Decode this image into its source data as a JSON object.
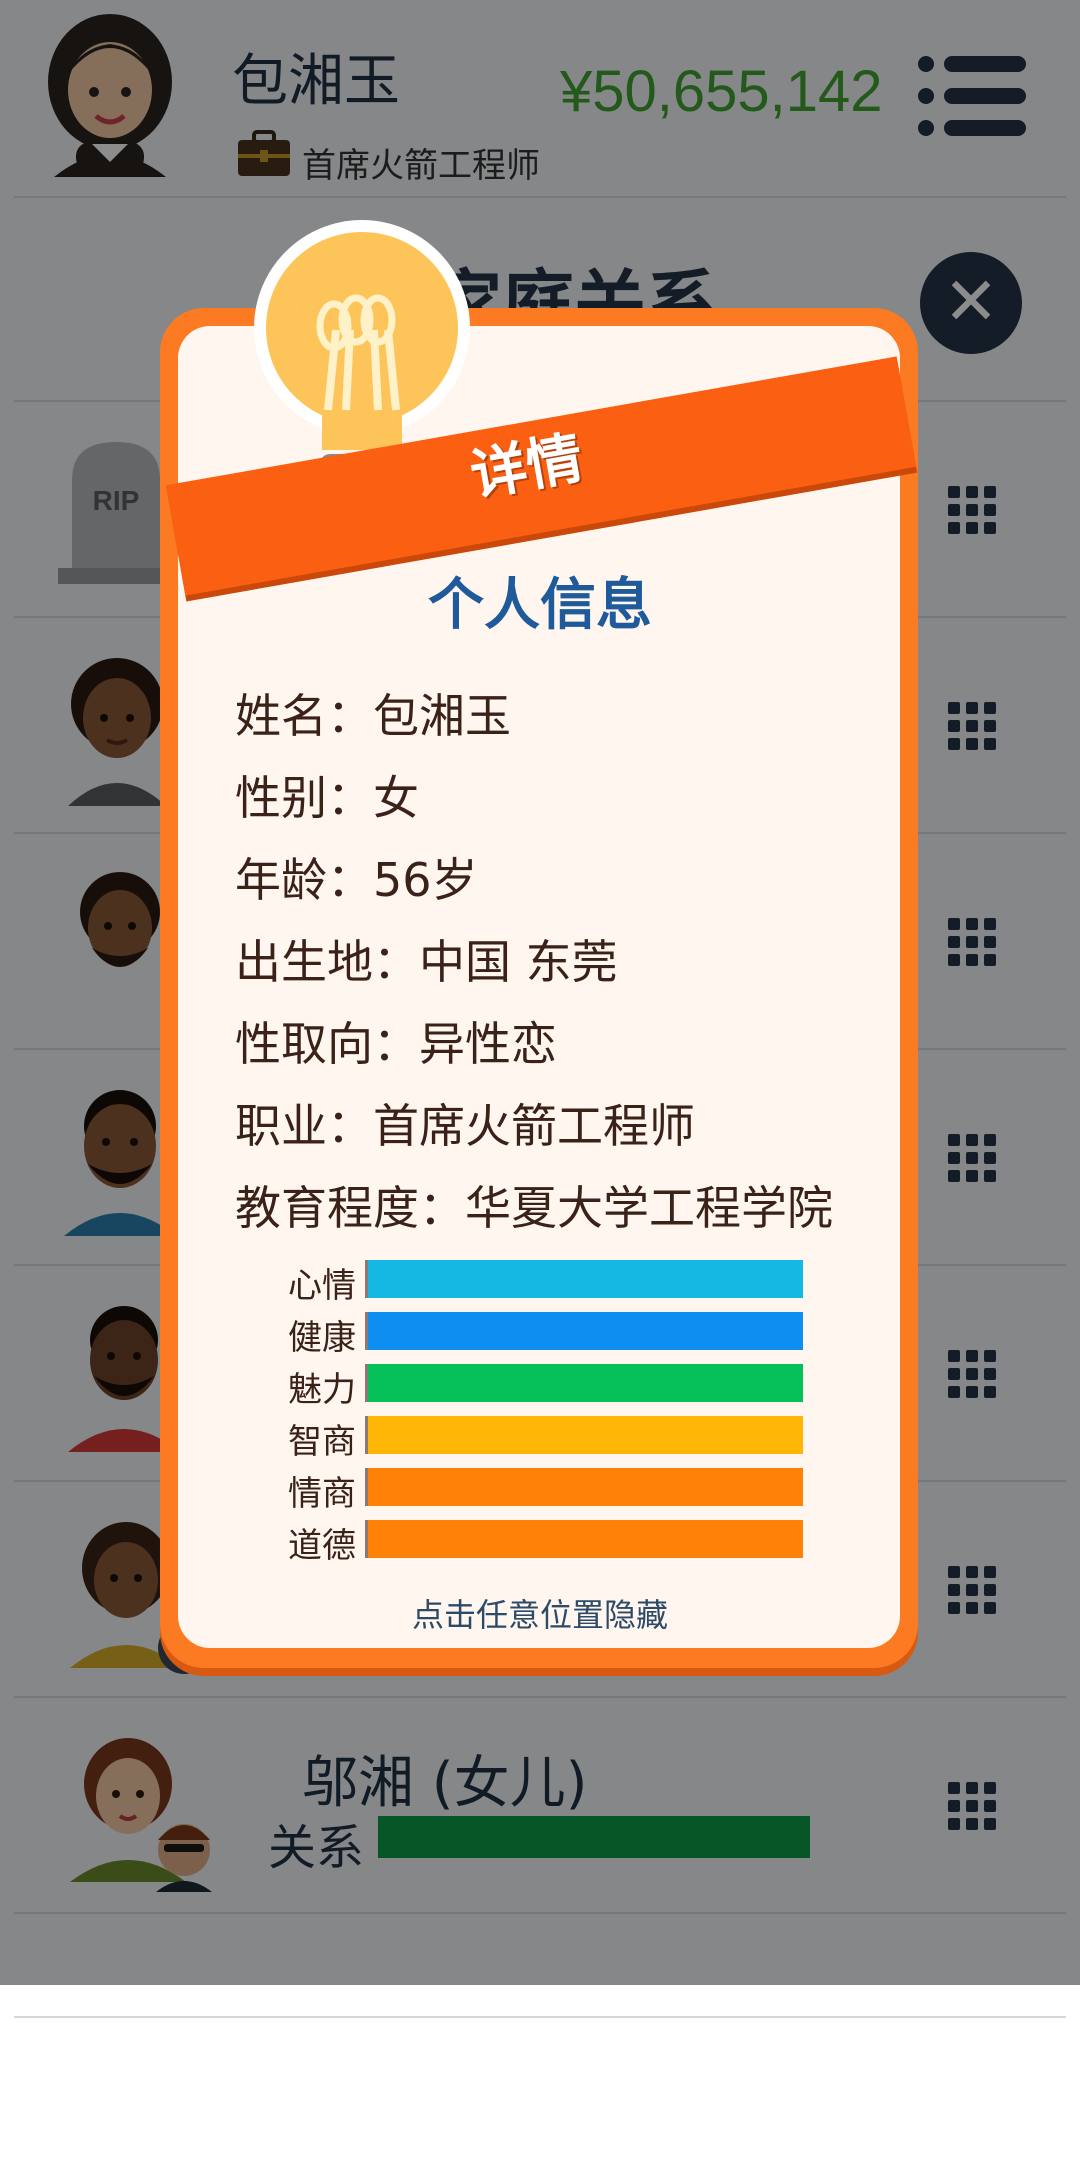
{
  "header": {
    "name": "包湘玉",
    "job": "首席火箭工程师",
    "money": "¥50,655,142"
  },
  "section": {
    "title": "家庭关系"
  },
  "rows": [
    {
      "label": "RIP"
    },
    {
      "name": "邬湘 (女儿)",
      "relation_label": "关系",
      "relation_level": 0.73
    }
  ],
  "modal": {
    "banner": "详情",
    "title": "个人信息",
    "info": [
      {
        "key": "姓名",
        "value": "包湘玉"
      },
      {
        "key": "性别",
        "value": "女"
      },
      {
        "key": "年龄",
        "value": "56岁"
      },
      {
        "key": "出生地",
        "value": "中国 东莞"
      },
      {
        "key": "性取向",
        "value": "异性恋"
      },
      {
        "key": "职业",
        "value": "首席火箭工程师"
      },
      {
        "key": "教育程度",
        "value": "华夏大学工程学院"
      }
    ],
    "stats": [
      {
        "label": "心情",
        "level": 1.0,
        "color": "#15b8e2"
      },
      {
        "label": "健康",
        "level": 1.0,
        "color": "#0d8ef0"
      },
      {
        "label": "魅力",
        "level": 1.0,
        "color": "#06c05a"
      },
      {
        "label": "智商",
        "level": 1.0,
        "color": "#ffb606"
      },
      {
        "label": "情商",
        "level": 1.0,
        "color": "#ff8208"
      },
      {
        "label": "道德",
        "level": 1.0,
        "color": "#ff8208"
      }
    ],
    "hint": "点击任意位置隐藏"
  },
  "icons": {
    "menu": "hamburger-menu-icon",
    "close": "close-icon",
    "grid": "grid-icon",
    "briefcase": "briefcase-icon",
    "bulb": "lightbulb-icon"
  }
}
